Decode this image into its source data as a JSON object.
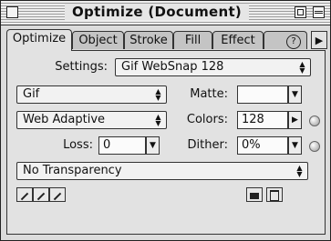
{
  "window": {
    "title": "Optimize (Document)"
  },
  "tabs": [
    {
      "label": "Optimize",
      "active": true
    },
    {
      "label": "Object",
      "active": false
    },
    {
      "label": "Stroke",
      "active": false
    },
    {
      "label": "Fill",
      "active": false
    },
    {
      "label": "Effect",
      "active": false
    }
  ],
  "settings": {
    "label": "Settings:",
    "value": "Gif WebSnap 128"
  },
  "format": {
    "value": "Gif"
  },
  "palette_select": {
    "value": "Web Adaptive"
  },
  "matte": {
    "label": "Matte:",
    "value": ""
  },
  "colors": {
    "label": "Colors:",
    "value": "128"
  },
  "loss": {
    "label": "Loss:",
    "value": "0"
  },
  "dither": {
    "label": "Dither:",
    "value": "0%"
  },
  "transparency": {
    "value": "No Transparency"
  },
  "icons": {
    "help": "help-icon",
    "panel_menu": "panel-menu-arrow-icon",
    "eyedroppers": [
      "eyedropper-icon",
      "eyedropper-add-icon",
      "eyedropper-subtract-icon"
    ],
    "save": "save-settings-icon",
    "delete": "trash-icon"
  }
}
